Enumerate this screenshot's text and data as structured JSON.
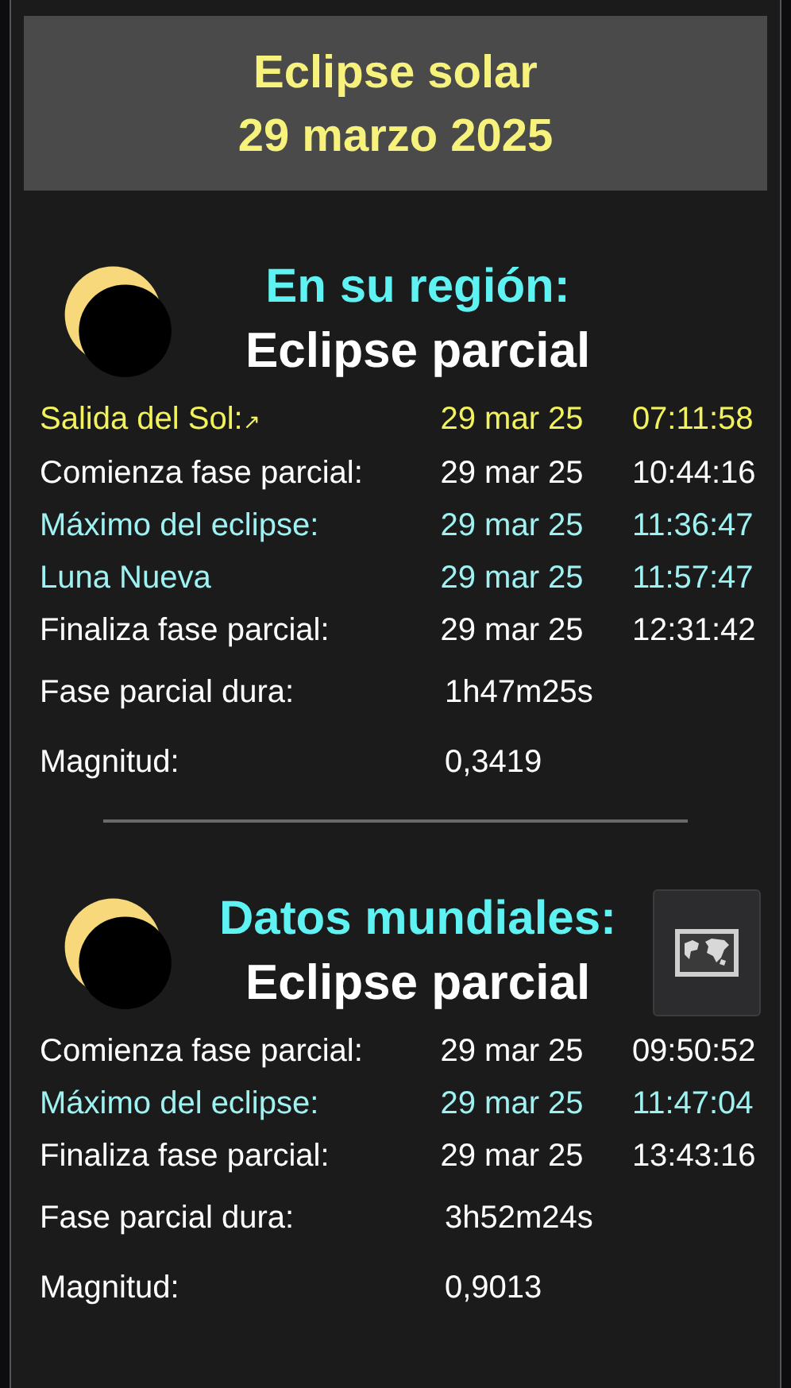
{
  "title": [
    "Eclipse solar",
    "29 marzo 2025"
  ],
  "sections": [
    {
      "heading": "En su región:",
      "type": "Eclipse parcial",
      "events": [
        {
          "kind": "sunrise",
          "label": "Salida del Sol:",
          "mark": "↗",
          "date": "29 mar 25",
          "time": "07:11:58"
        },
        {
          "kind": "normal",
          "label": "Comienza fase parcial:",
          "date": "29 mar 25",
          "time": "10:44:16"
        },
        {
          "kind": "highlight",
          "label": "Máximo del eclipse:",
          "date": "29 mar 25",
          "time": "11:36:47"
        },
        {
          "kind": "highlight",
          "label": "Luna Nueva",
          "date": "29 mar 25",
          "time": "11:57:47"
        },
        {
          "kind": "normal",
          "label": "Finaliza fase parcial:",
          "date": "29 mar 25",
          "time": "12:31:42"
        }
      ],
      "stats": [
        {
          "label": "Fase parcial dura:",
          "value": "1h47m25s"
        },
        {
          "label": "Magnitud:",
          "value": "0,3419"
        }
      ]
    },
    {
      "heading": "Datos mundiales:",
      "type": "Eclipse parcial",
      "map_button": true,
      "events": [
        {
          "kind": "normal",
          "label": "Comienza fase parcial:",
          "date": "29 mar 25",
          "time": "09:50:52"
        },
        {
          "kind": "highlight",
          "label": "Máximo del eclipse:",
          "date": "29 mar 25",
          "time": "11:47:04"
        },
        {
          "kind": "normal",
          "label": "Finaliza fase parcial:",
          "date": "29 mar 25",
          "time": "13:43:16"
        }
      ],
      "stats": [
        {
          "label": "Fase parcial dura:",
          "value": "3h52m24s"
        },
        {
          "label": "Magnitud:",
          "value": "0,9013"
        }
      ]
    }
  ]
}
